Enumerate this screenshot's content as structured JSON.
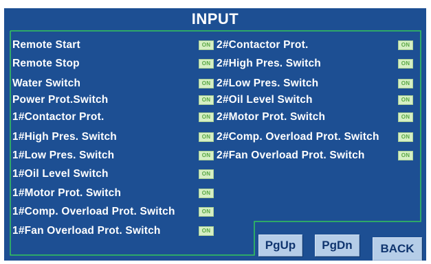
{
  "screen": {
    "title": "INPUT",
    "frame_color": "#34c75a",
    "background_color": "#1d4f93"
  },
  "inputs": {
    "left": [
      {
        "label": "Remote Start",
        "status": "ON"
      },
      {
        "label": "Remote Stop",
        "status": "ON"
      },
      {
        "label": "Water Switch",
        "status": "ON"
      },
      {
        "label": "Power Prot.Switch",
        "status": "ON"
      },
      {
        "label": "1#Contactor Prot.",
        "status": "ON"
      },
      {
        "label": "1#High Pres. Switch",
        "status": "ON"
      },
      {
        "label": "1#Low Pres. Switch",
        "status": "ON"
      },
      {
        "label": "1#Oil Level Switch",
        "status": "ON"
      },
      {
        "label": "1#Motor Prot. Switch",
        "status": "ON"
      },
      {
        "label": "1#Comp. Overload Prot. Switch",
        "status": "ON"
      },
      {
        "label": "1#Fan Overload  Prot. Switch",
        "status": "ON"
      }
    ],
    "right": [
      {
        "label": "2#Contactor Prot.",
        "status": "ON"
      },
      {
        "label": "2#High Pres. Switch",
        "status": "ON"
      },
      {
        "label": "2#Low Pres. Switch",
        "status": "ON"
      },
      {
        "label": "2#Oil Level Switch",
        "status": "ON"
      },
      {
        "label": "2#Motor Prot. Switch",
        "status": "ON"
      },
      {
        "label": "2#Comp. Overload Prot. Switch",
        "status": "ON"
      },
      {
        "label": "2#Fan Overload  Prot. Switch",
        "status": "ON"
      }
    ]
  },
  "buttons": {
    "pgup": "PgUp",
    "pgdn": "PgDn",
    "back": "BACK"
  }
}
